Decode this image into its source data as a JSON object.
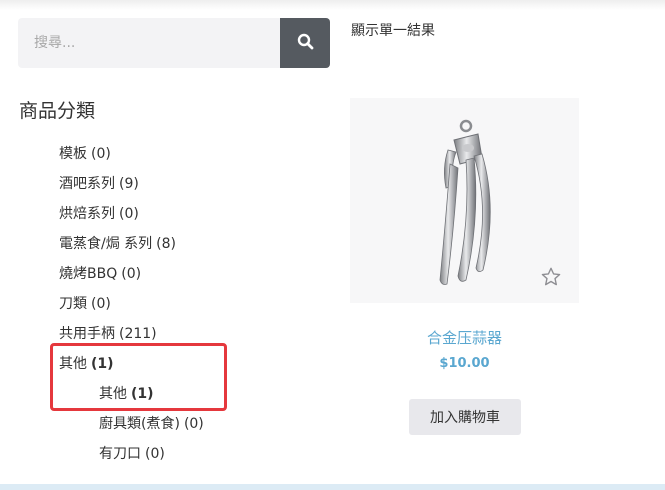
{
  "search": {
    "placeholder": "搜尋..."
  },
  "sidebar": {
    "title": "商品分類",
    "categories": [
      {
        "name": "模板",
        "count": "(0)"
      },
      {
        "name": "酒吧系列",
        "count": "(9)"
      },
      {
        "name": "烘焙系列",
        "count": "(0)"
      },
      {
        "name": "電蒸食/焗 系列",
        "count": "(8)"
      },
      {
        "name": "燒烤BBQ",
        "count": "(0)"
      },
      {
        "name": "刀類",
        "count": "(0)"
      },
      {
        "name": "共用手柄",
        "count": "(211)"
      },
      {
        "name": "其他",
        "count": "(1)"
      },
      {
        "name": "其他",
        "count": "(1)"
      },
      {
        "name": "廚具類(煮食)",
        "count": "(0)"
      },
      {
        "name": "有刀口",
        "count": "(0)"
      }
    ]
  },
  "results": {
    "count_text": "顯示單一結果"
  },
  "product": {
    "name": "合金压蒜器",
    "price": "$10.00",
    "add_to_cart": "加入購物車"
  },
  "colors": {
    "link": "#5aa7d0",
    "highlight": "#e5383d",
    "search_button": "#555a60"
  },
  "icons": {
    "search": "search-icon",
    "wishlist": "star-outline-icon"
  }
}
